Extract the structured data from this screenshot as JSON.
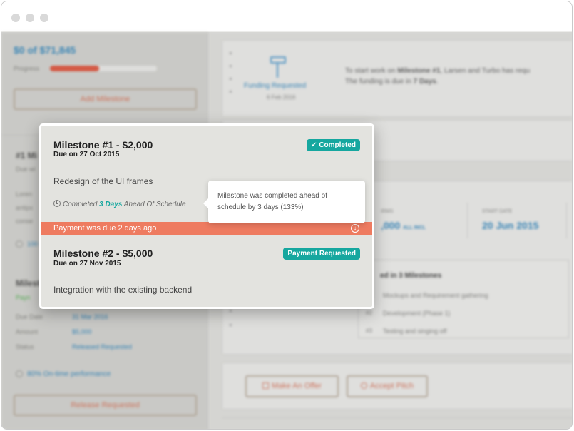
{
  "background": {
    "sidebar": {
      "funded_amount": "$0 of $71,845",
      "progress_label": "Progress",
      "progress_percent": 46,
      "add_milestone_label": "Add Milestone",
      "section1_title": "#1 Mi",
      "section1_sub": "Due wi",
      "section1_lines": [
        "Loren",
        "antipx",
        "conse"
      ],
      "section1_link": "100",
      "section2_title": "Milesto",
      "section2_status": "Payn",
      "rows": [
        {
          "label": "Due Date",
          "value": "31 Mar 2016"
        },
        {
          "label": "Amount",
          "value": "$5,000"
        },
        {
          "label": "Status",
          "value": "Released Requested"
        }
      ],
      "ontime_label": "80% On-time performance",
      "release_label": "Release Requested"
    },
    "main": {
      "funding_label": "Funding Requested",
      "funding_date": "6 Feb 2016",
      "notice_line1_pre": "To start work on ",
      "notice_line1_bold": "Milestone #1",
      "notice_line1_post": ", Larsen and Turbo has requ",
      "notice_line2_pre": "The funding is due in ",
      "notice_line2_bold": "7 Days",
      "notice_line2_post": ".",
      "stat1_label": "IRMS",
      "stat1_value": ",000",
      "stat1_suffix": "ALL INCL",
      "stat2_label": "START DATE",
      "stat2_value": "20 Jun 2015",
      "milestones_heading": "ed in 3 Milestones",
      "milestone_items": [
        {
          "num": "",
          "text": "Mockups and Requirement gathering"
        },
        {
          "num": "#2",
          "text": "Development (Phase 1)"
        },
        {
          "num": "#3",
          "text": "Testing and singing off"
        }
      ],
      "make_offer_label": "Make An Offer",
      "accept_pitch_label": "Accept Pitch"
    }
  },
  "popup": {
    "milestone1": {
      "title": "Milestone #1 - $2,000",
      "due": "Due on 27 Oct 2015",
      "badge": "Completed",
      "description": "Redesign of the UI frames",
      "completed_pre": "Completed ",
      "completed_days": "3 Days",
      "completed_post": " Ahead Of Schedule"
    },
    "payment_notice": "Payment was due 2 days ago",
    "milestone2": {
      "title": "Milestone #2 - $5,000",
      "due": "Due on 27 Nov 2015",
      "badge": "Payment Requested",
      "description": "Integration with the existing backend"
    }
  },
  "tooltip": {
    "line1": "Milestone was completed ahead of",
    "line2": "schedule by 3 days (133%)"
  },
  "colors": {
    "accent": "#16a79f",
    "alert": "#ee7b60",
    "link": "#3a8fc6"
  }
}
